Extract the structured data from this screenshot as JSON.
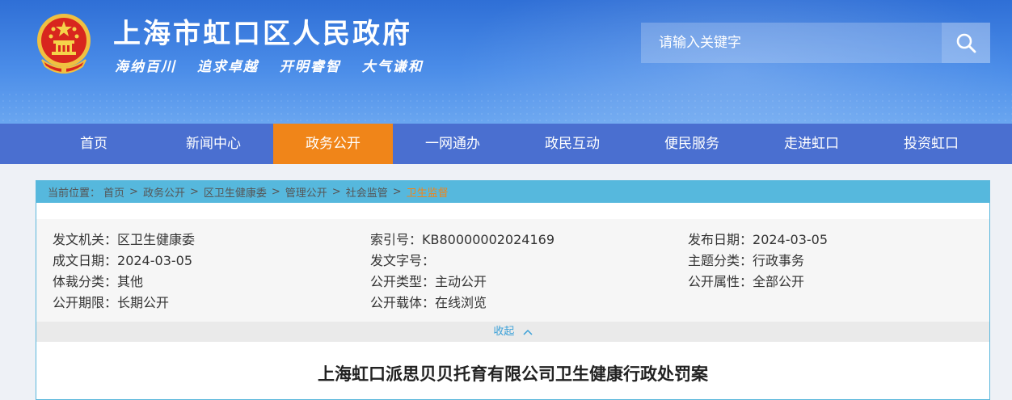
{
  "header": {
    "site_title": "上海市虹口区人民政府",
    "slogans": [
      "海纳百川",
      "追求卓越",
      "开明睿智",
      "大气谦和"
    ],
    "search_placeholder": "请输入关键字"
  },
  "nav": {
    "items": [
      "首页",
      "新闻中心",
      "政务公开",
      "一网通办",
      "政民互动",
      "便民服务",
      "走进虹口",
      "投资虹口"
    ],
    "active": "政务公开"
  },
  "breadcrumb": {
    "label": "当前位置：",
    "items": [
      "首页",
      "政务公开",
      "区卫生健康委",
      "管理公开",
      "社会监管",
      "卫生监督"
    ],
    "separator": ">"
  },
  "meta": {
    "issuer_label": "发文机关：",
    "issuer": "区卫生健康委",
    "index_label": "索引号：",
    "index": "KB80000002024169",
    "publish_label": "发布日期：",
    "publish": "2024-03-05",
    "created_label": "成文日期：",
    "created": "2024-03-05",
    "docno_label": "发文字号：",
    "docno": "",
    "topic_label": "主题分类：",
    "topic": "行政事务",
    "genre_label": "体裁分类：",
    "genre": "其他",
    "opentype_label": "公开类型：",
    "opentype": "主动公开",
    "openattr_label": "公开属性：",
    "openattr": "全部公开",
    "period_label": "公开期限：",
    "period": "长期公开",
    "carrier_label": "公开载体：",
    "carrier": "在线浏览"
  },
  "collapse_label": "收起",
  "document": {
    "title": "上海虹口派思贝贝托育有限公司卫生健康行政处罚案"
  },
  "colors": {
    "header_blue": "#2f6fd6",
    "nav_blue": "#4a6fd0",
    "nav_active": "#f08519",
    "breadcrumb_bg": "#56b8dd",
    "breadcrumb_current": "#f08519",
    "collapse_text": "#3aa0d8"
  },
  "icons": {
    "emblem": "national-emblem-icon",
    "search": "search-icon",
    "collapse": "chevron-up-icon"
  }
}
